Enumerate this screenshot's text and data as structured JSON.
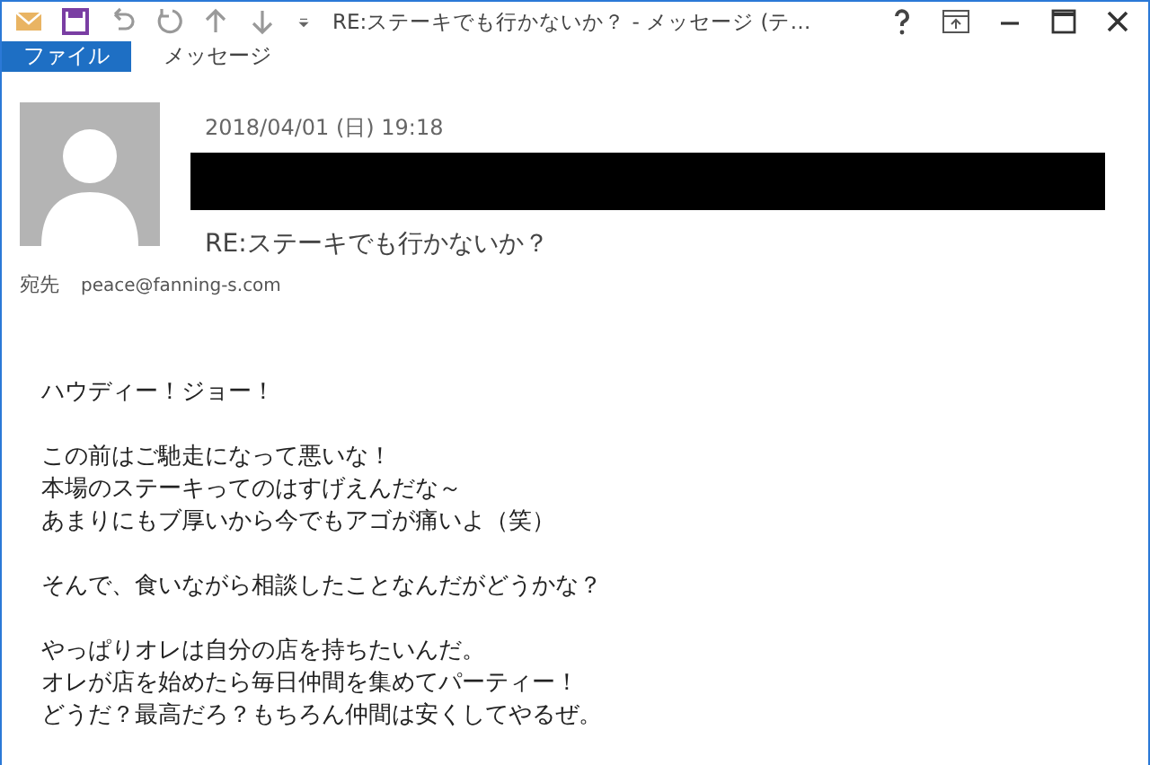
{
  "window": {
    "title": "RE:ステーキでも行かないか？ - メッセージ (テ…"
  },
  "tabs": [
    {
      "label": "ファイル",
      "selected": true
    },
    {
      "label": "メッセージ",
      "selected": false
    }
  ],
  "message": {
    "date": "2018/04/01 (日) 19:18",
    "subject": "RE:ステーキでも行かないか？",
    "to_label": "宛先",
    "to": "peace@fanning-s.com"
  },
  "body": [
    [
      "ハウディー！ジョー！"
    ],
    [
      "この前はご馳走になって悪いな！",
      "本場のステーキってのはすげえんだな～",
      "あまりにもブ厚いから今でもアゴが痛いよ（笑）"
    ],
    [
      "そんで、食いながら相談したことなんだがどうかな？"
    ],
    [
      "やっぱりオレは自分の店を持ちたいんだ。",
      "オレが店を始めたら毎日仲間を集めてパーティー！",
      "どうだ？最高だろ？もちろん仲間は安くしてやるぜ。"
    ]
  ]
}
